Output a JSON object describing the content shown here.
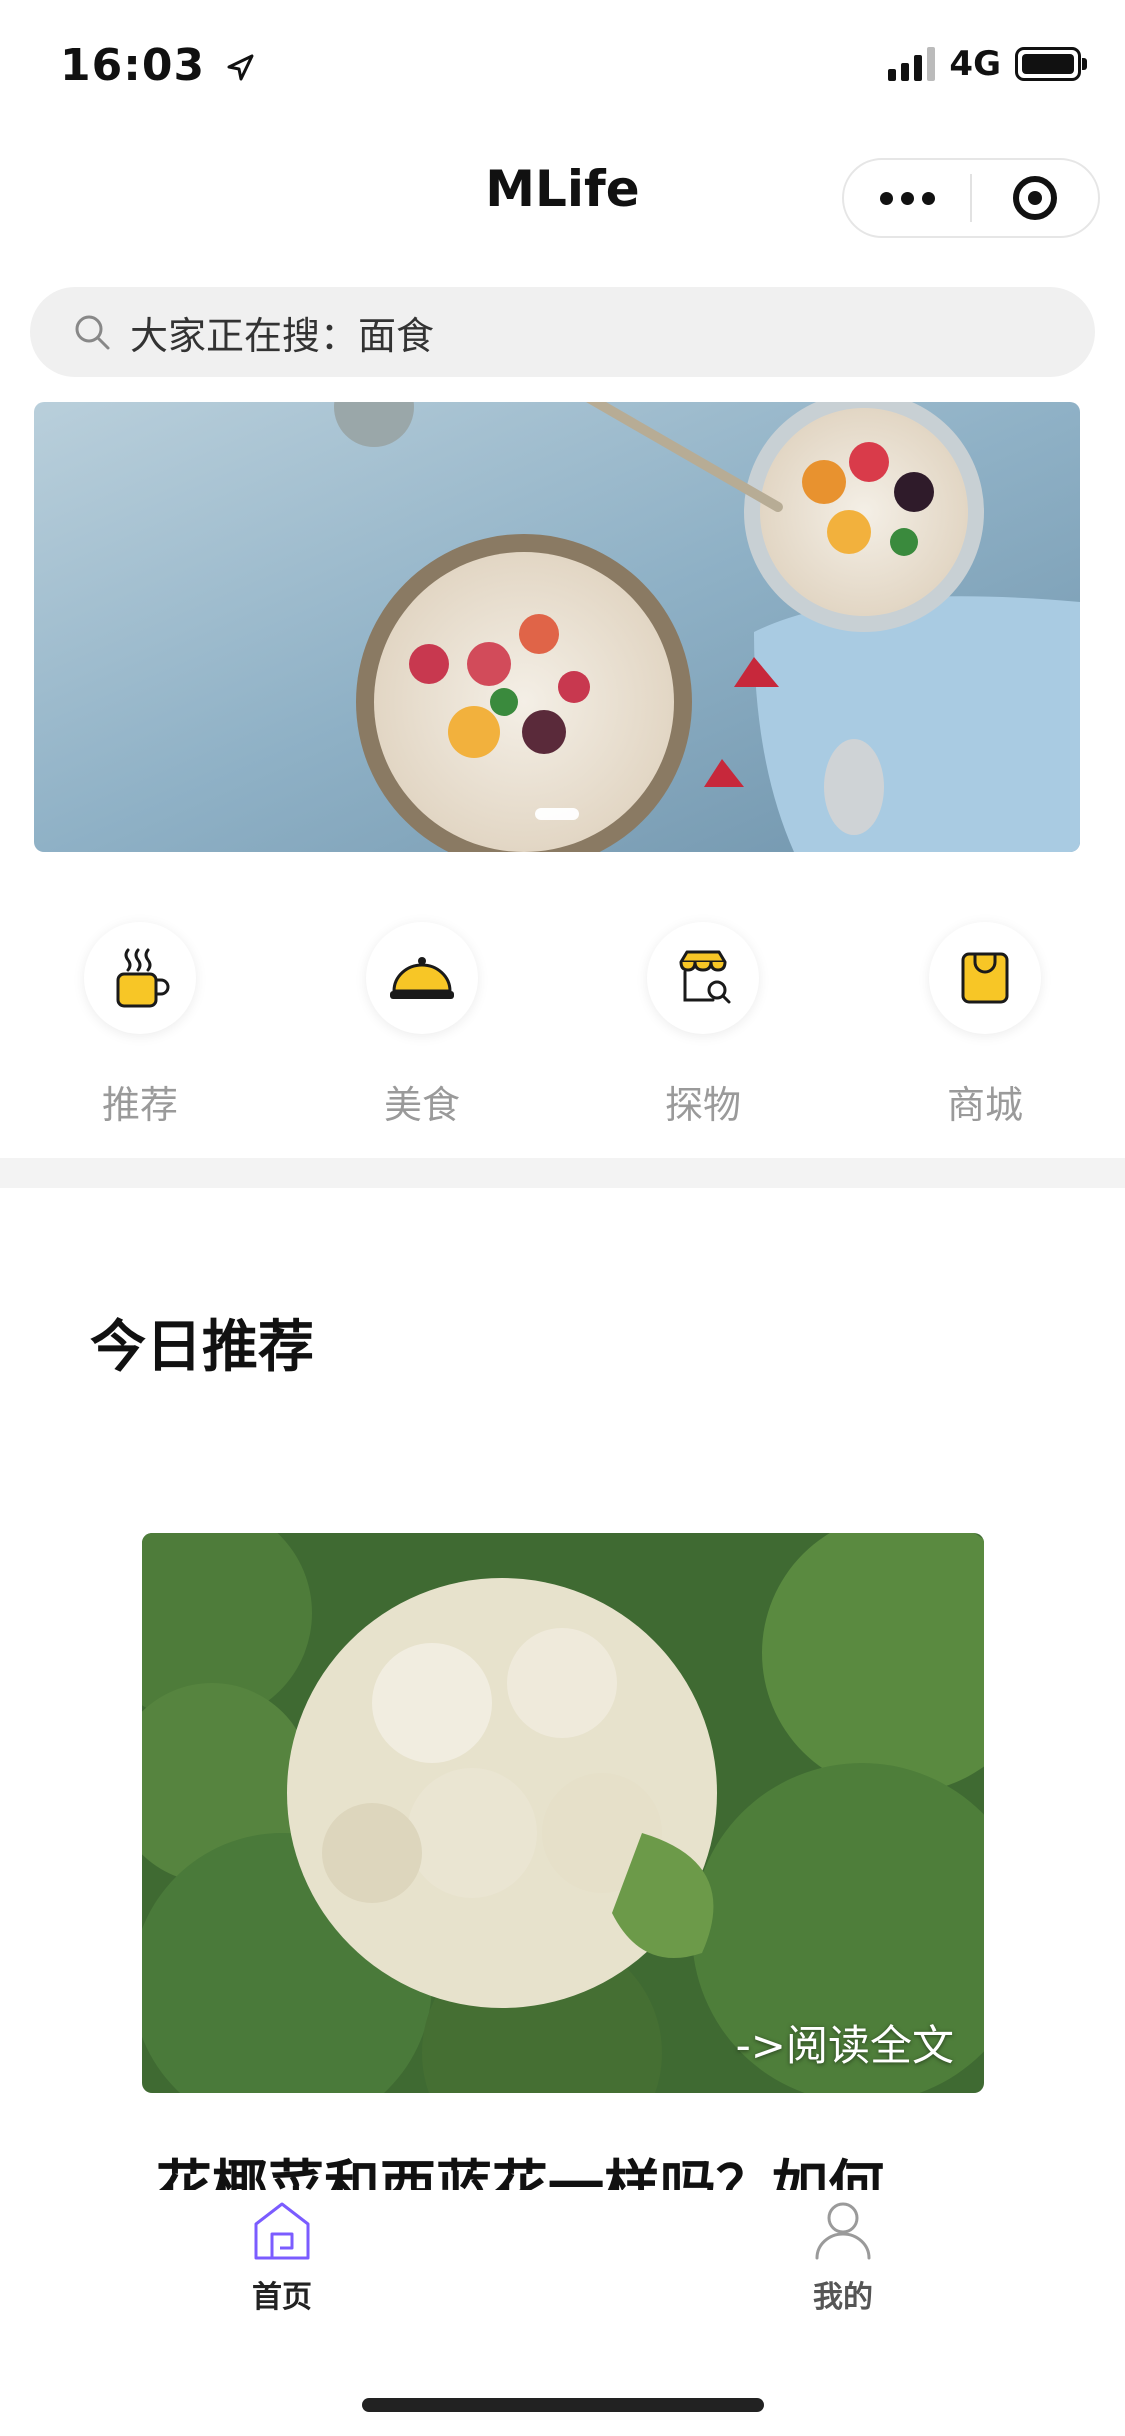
{
  "status_bar": {
    "time": "16:03",
    "network": "4G"
  },
  "nav": {
    "title": "MLife",
    "more_icon": "ellipsis-icon",
    "target_icon": "target-icon"
  },
  "search": {
    "placeholder": "大家正在搜：面食",
    "icon": "search-icon"
  },
  "banner": {
    "image": "breakfast-bowls-photo"
  },
  "categories": [
    {
      "label": "推荐",
      "icon": "coffee-cup-icon"
    },
    {
      "label": "美食",
      "icon": "food-cloche-icon"
    },
    {
      "label": "探物",
      "icon": "shop-search-icon"
    },
    {
      "label": "商城",
      "icon": "shopping-bag-icon"
    }
  ],
  "section": {
    "title": "今日推荐"
  },
  "article": {
    "image": "cauliflower-broccoli-photo",
    "read_more": "->阅读全文",
    "title": "花椰菜和西蓝花一样吗？如何"
  },
  "tabbar": {
    "items": [
      {
        "label": "首页",
        "icon": "home-icon",
        "active": true
      },
      {
        "label": "我的",
        "icon": "user-icon",
        "active": false
      }
    ],
    "active_color": "#7b5cff"
  },
  "colors": {
    "accent": "#f7c626",
    "icon_stroke": "#1a1a1a"
  }
}
